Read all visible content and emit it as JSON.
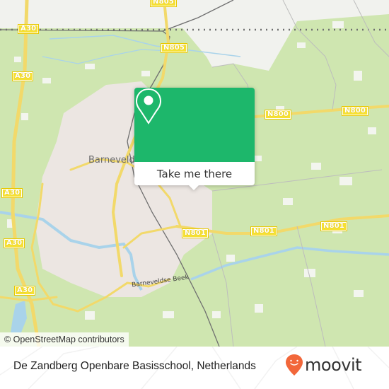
{
  "map": {
    "place_labels": [
      {
        "text": "Barneveld",
        "name": "barneveld"
      }
    ],
    "water_labels": [
      {
        "text": "Barneveldse Beek",
        "name": "barneveldse-beek"
      }
    ],
    "road_shields": [
      {
        "text": "A30"
      },
      {
        "text": "A30"
      },
      {
        "text": "A30"
      },
      {
        "text": "A30"
      },
      {
        "text": "A30"
      },
      {
        "text": "N805"
      },
      {
        "text": "N805"
      },
      {
        "text": "N800"
      },
      {
        "text": "N800"
      },
      {
        "text": "N801"
      },
      {
        "text": "N801"
      },
      {
        "text": "N801"
      }
    ],
    "attribution": "© OpenStreetMap contributors",
    "colors": {
      "land": "#cfe6b0",
      "urban": "#ece6e2",
      "water": "#a9d3ea",
      "road": "#f6e06a",
      "shield": "#f6e033"
    }
  },
  "popup": {
    "icon": "map-pin-icon",
    "button_label": "Take me there",
    "color": "#1db76b"
  },
  "footer": {
    "place_title": "De Zandberg Openbare Basisschool, Netherlands",
    "brand": {
      "name": "moovit",
      "icon": "moovit-pin-logo-icon",
      "color": "#f2673a"
    }
  }
}
